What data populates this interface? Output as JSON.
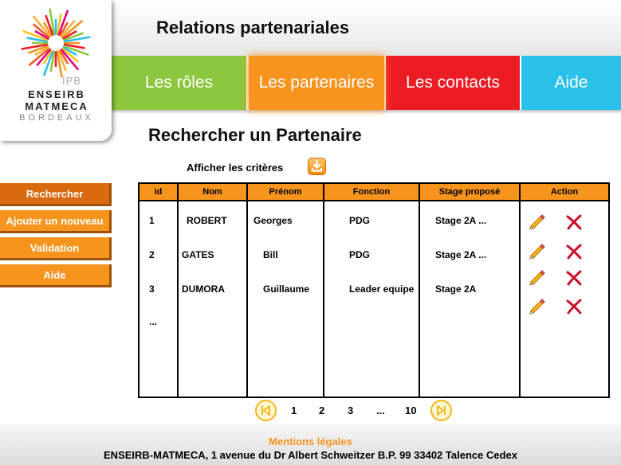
{
  "header": {
    "title": "Relations partenariales"
  },
  "logo": {
    "ipb": "IPB",
    "line1": "ENSEIRB",
    "line2": "MATMECA",
    "line3": "BORDEAUX"
  },
  "tabs": [
    {
      "label": "Les rôles",
      "color": "#8cc63e"
    },
    {
      "label": "Les partenaires",
      "color": "#f7941d",
      "active": true
    },
    {
      "label": "Les contacts",
      "color": "#ed1c24"
    },
    {
      "label": "Aide",
      "color": "#29c0ea"
    }
  ],
  "page_title": "Rechercher un Partenaire",
  "sidebar": {
    "items": [
      {
        "label": "Rechercher"
      },
      {
        "label": "Ajouter un nouveau"
      },
      {
        "label": "Validation"
      },
      {
        "label": "Aide"
      }
    ]
  },
  "criteria": {
    "label": "Afficher les critères",
    "icon": "download-icon"
  },
  "table": {
    "columns": [
      "id",
      "Nom",
      "Prénom",
      "Fonction",
      "Stage proposé",
      "Action"
    ],
    "rows": [
      {
        "id": "1",
        "nom": "ROBERT",
        "prenom": "Georges",
        "fonction": "PDG",
        "stage": "Stage 2A ..."
      },
      {
        "id": "2",
        "nom": "GATES",
        "prenom": "Bill",
        "fonction": "PDG",
        "stage": "Stage 2A ..."
      },
      {
        "id": "3",
        "nom": "DUMORA",
        "prenom": "Guillaume",
        "fonction": "Leader equipe",
        "stage": "Stage 2A"
      }
    ],
    "more": "...",
    "action_icons": [
      "pencil-icon",
      "delete-x-icon"
    ]
  },
  "pagination": {
    "pages": [
      "1",
      "2",
      "3",
      "...",
      "10"
    ],
    "first_icon": "first-page-icon",
    "last_icon": "last-page-icon"
  },
  "footer": {
    "legal": "Mentions légales",
    "address": "ENSEIRB-MATMECA, 1 avenue du Dr Albert Schweitzer B.P. 99 33402 Talence Cedex"
  },
  "colors": {
    "orange": "#f7941d",
    "green": "#8cc63e",
    "red": "#ed1c24",
    "blue": "#29c0ea"
  }
}
